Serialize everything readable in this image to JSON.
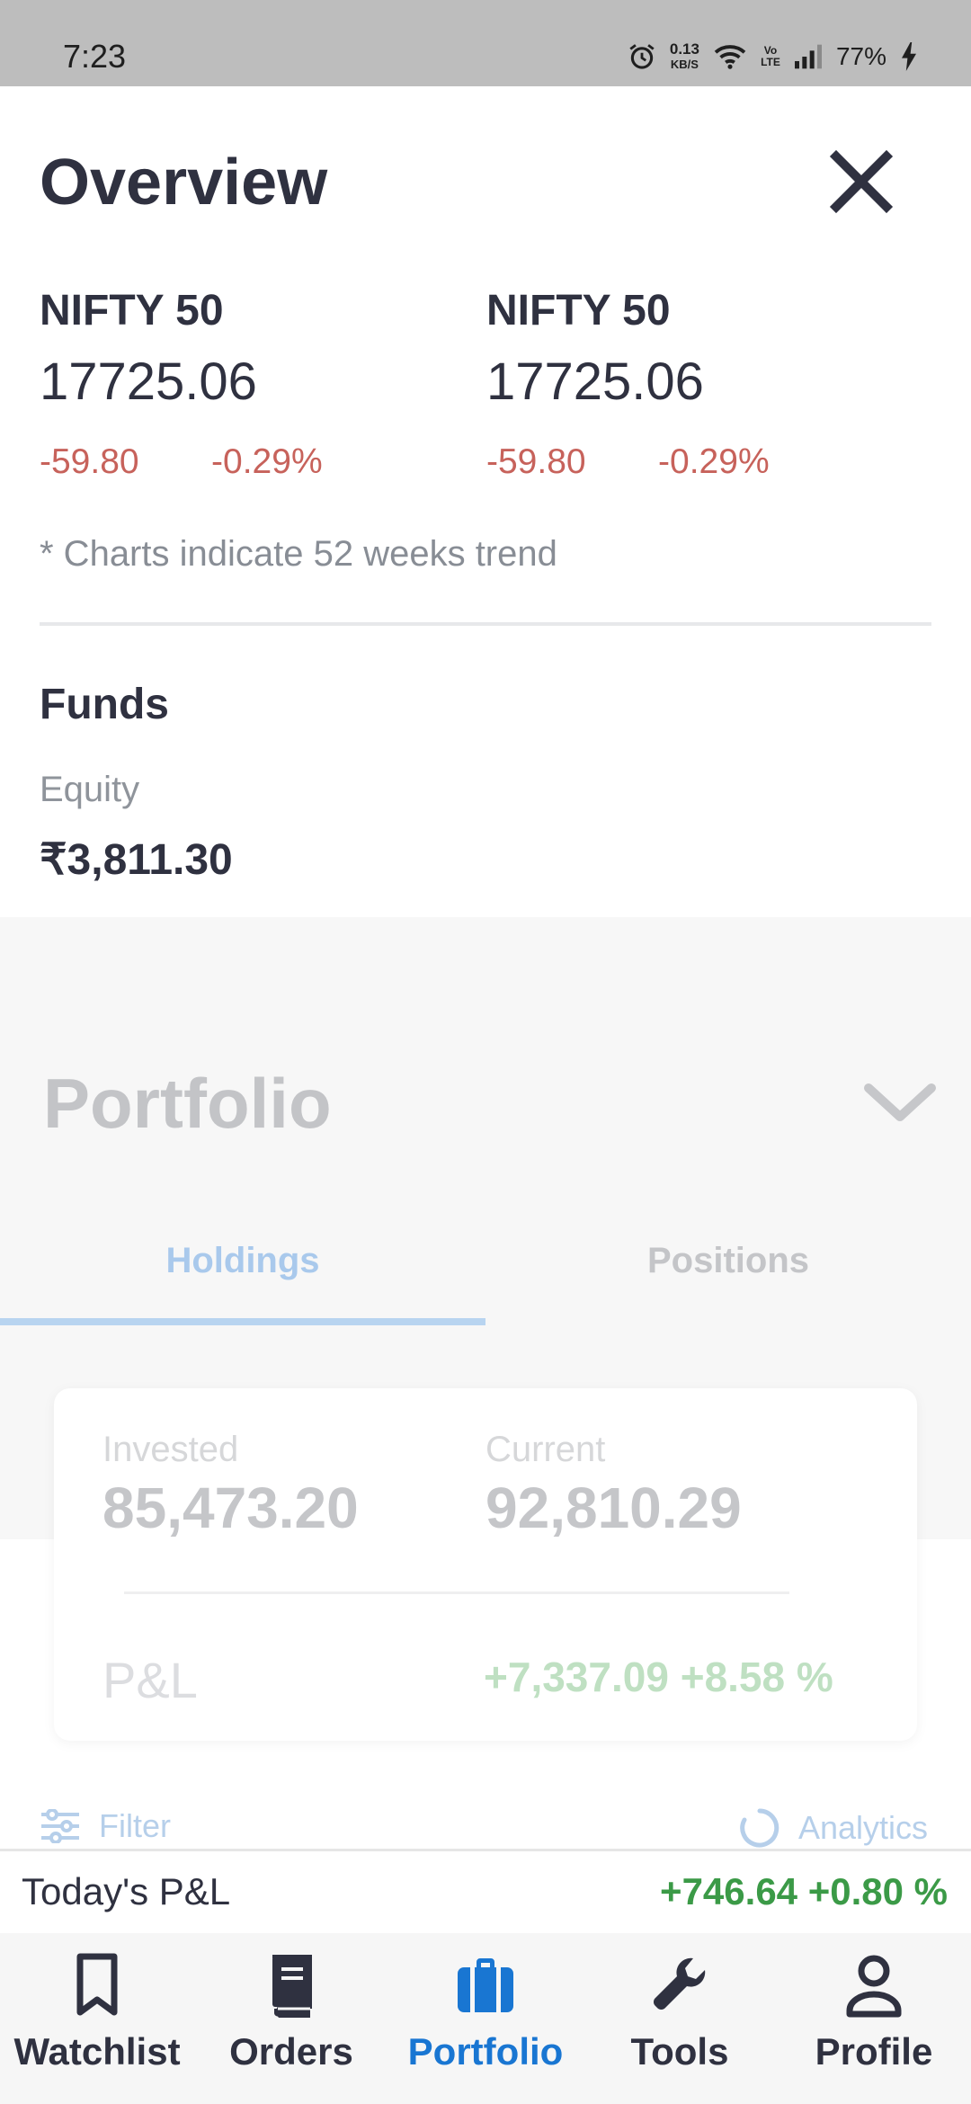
{
  "status_bar": {
    "time": "7:23",
    "net_speed_value": "0.13",
    "net_speed_unit": "KB/S",
    "volte_label": "Vo LTE",
    "battery": "77%",
    "icons": [
      "alarm-icon",
      "wifi-icon",
      "volte-icon",
      "signal-icon",
      "battery-charging-icon"
    ]
  },
  "overview": {
    "title": "Overview",
    "indices": [
      {
        "name": "NIFTY 50",
        "value": "17725.06",
        "change": "-59.80",
        "change_pct": "-0.29%"
      },
      {
        "name": "NIFTY 50",
        "value": "17725.06",
        "change": "-59.80",
        "change_pct": "-0.29%"
      }
    ],
    "note": "* Charts indicate 52 weeks trend",
    "funds": {
      "title": "Funds",
      "equity_label": "Equity",
      "equity_value": "₹3,811.30"
    }
  },
  "portfolio": {
    "title": "Portfolio",
    "tabs": [
      {
        "label": "Holdings",
        "active": true
      },
      {
        "label": "Positions",
        "active": false
      }
    ],
    "summary": {
      "invested_label": "Invested",
      "invested_value": "85,473.20",
      "current_label": "Current",
      "current_value": "92,810.29",
      "pl_label": "P&L",
      "pl_value": "+7,337.09 +8.58 %"
    },
    "filter_label": "Filter",
    "analytics_label": "Analytics"
  },
  "todays_pl": {
    "label": "Today's P&L",
    "value": "+746.64 +0.80 %"
  },
  "bottom_nav": {
    "active": "Portfolio",
    "items": [
      {
        "label": "Watchlist",
        "icon": "bookmark-icon"
      },
      {
        "label": "Orders",
        "icon": "book-icon"
      },
      {
        "label": "Portfolio",
        "icon": "briefcase-icon"
      },
      {
        "label": "Tools",
        "icon": "wrench-icon"
      },
      {
        "label": "Profile",
        "icon": "person-icon"
      }
    ]
  },
  "colors": {
    "accent": "#1976d2",
    "negative": "#c7625b",
    "positive": "#3b9a47",
    "text_primary": "#2f3140"
  }
}
